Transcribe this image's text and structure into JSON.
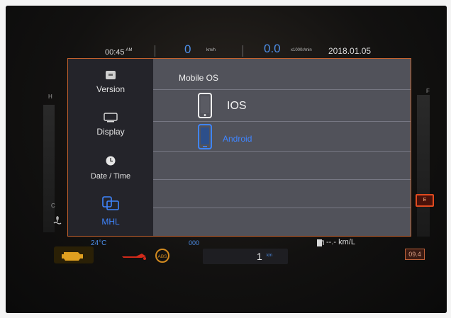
{
  "status": {
    "clock": "00:45",
    "ampm": "AM",
    "speed_value": "0",
    "speed_unit": "km/h",
    "rpm_value": "0.0",
    "rpm_unit": "x1000r/min",
    "date": "2018.01.05"
  },
  "gauges": {
    "temp_high": "H",
    "temp_low": "C",
    "fuel_full": "F",
    "fuel_indicator": "E"
  },
  "sidebar": {
    "items": [
      {
        "label": "Version",
        "icon": "version-icon",
        "active": false
      },
      {
        "label": "Display",
        "icon": "display-icon",
        "active": false
      },
      {
        "label": "Date / Time",
        "icon": "clock-icon",
        "active": false
      },
      {
        "label": "MHL",
        "icon": "mhl-icon",
        "active": true
      }
    ]
  },
  "content": {
    "title": "Mobile OS",
    "options": [
      {
        "label": "IOS",
        "icon": "iphone-icon",
        "selected": false
      },
      {
        "label": "Android",
        "icon": "android-phone-icon",
        "selected": true
      }
    ]
  },
  "bottom": {
    "temperature": "24°C",
    "odometer": "000",
    "trip_value": "1",
    "trip_unit": "km",
    "fuel_economy": "--.- km/L",
    "right_value": "09.4"
  },
  "colors": {
    "accent": "#3f85ff",
    "screen_border": "#c5622d",
    "sidebar_bg": "#24242a",
    "content_bg": "#51525a",
    "warning_amber": "#e0a020",
    "warning_red": "#d22a1a",
    "abs_amber": "#d28a20"
  }
}
